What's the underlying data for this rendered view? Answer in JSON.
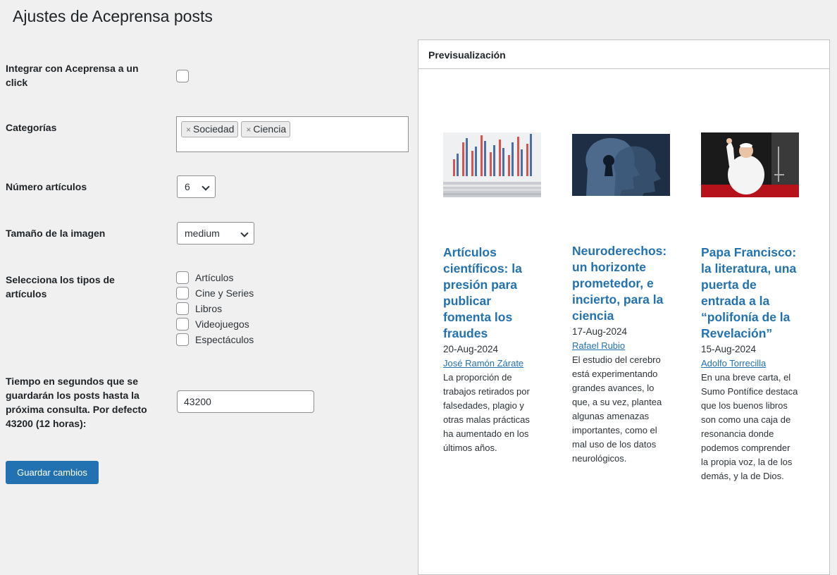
{
  "page": {
    "title": "Ajustes de Aceprensa posts"
  },
  "form": {
    "integrate_label": "Integrar con Aceprensa a un click",
    "categories_label": "Categorías",
    "categories": [
      "Sociedad",
      "Ciencia"
    ],
    "token_remove_glyph": "×",
    "num_articles_label": "Número artículos",
    "num_articles_value": "6",
    "image_size_label": "Tamaño de la imagen",
    "image_size_value": "medium",
    "types_label": "Selecciona los tipos de artículos",
    "types": [
      "Artículos",
      "Cine y Series",
      "Libros",
      "Videojuegos",
      "Espectáculos"
    ],
    "cache_label": "Tiempo en segundos que se guardarán los posts hasta la próxima consulta. Por defecto 43200 (12 horas):",
    "cache_value": "43200",
    "save_label": "Guardar cambios"
  },
  "preview": {
    "title": "Previsualización",
    "articles": [
      {
        "title": "Artículos científicos: la presión para publicar fomenta los fraudes",
        "date": "20-Aug-2024",
        "author": "José Ramón Zárate",
        "excerpt": "La proporción de trabajos retirados por falsedades, plagio y otras malas prácticas ha aumentado en los últimos años.",
        "image": "bar-chart-newspaper-photo"
      },
      {
        "title": "Neuroderechos: un horizonte prometedor, e incierto, para la ciencia",
        "date": "17-Aug-2024",
        "author": "Rafael Rubio",
        "excerpt": "El estudio del cerebro está experimentando grandes avances, lo que, a su vez, plantea algunas amenazas importantes, como el mal uso de los datos neurológicos.",
        "image": "digital-head-keyhole-photo"
      },
      {
        "title": "Papa Francisco: la literatura, una puerta de entrada a la “polifonía de la Revelación”",
        "date": "15-Aug-2024",
        "author": "Adolfo Torrecilla",
        "excerpt": "En una breve carta, el Sumo Pontífice destaca que los buenos libros son como una caja de resonancia donde podemos comprender la propia voz, la de los demás, y la de Dios.",
        "image": "pope-waving-photo"
      }
    ]
  },
  "colors": {
    "accent": "#2271b1",
    "background": "#f0f0f1",
    "text": "#1d2327"
  }
}
